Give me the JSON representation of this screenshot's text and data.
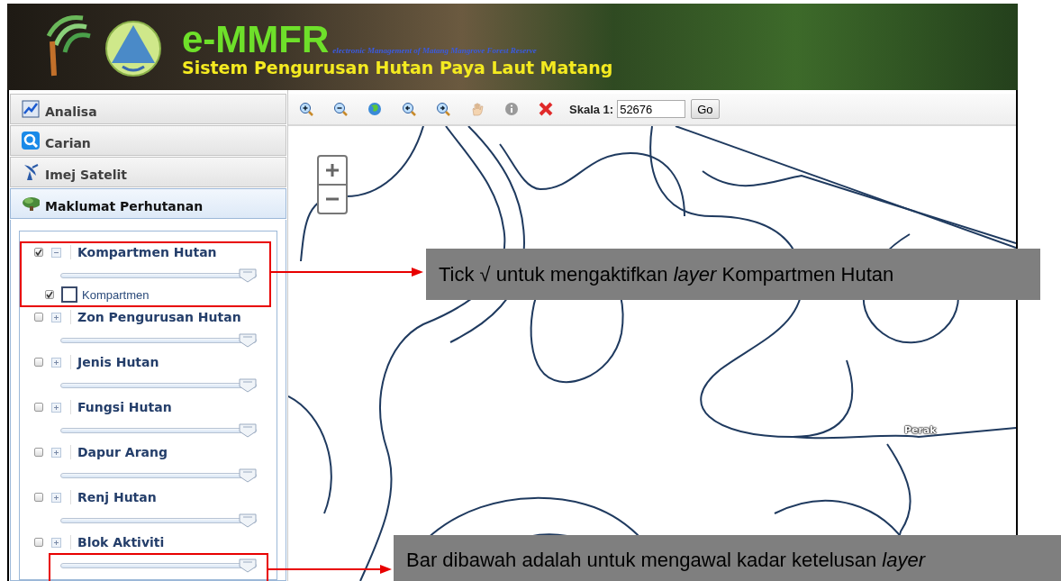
{
  "header": {
    "title": "e-MMFR",
    "tagline": "electronic Management of Matang Mangrove Forest Reserve",
    "subtitle": "Sistem Pengurusan Hutan Paya Laut Matang"
  },
  "sidebar": {
    "panels": [
      {
        "label": "Analisa",
        "expanded": false
      },
      {
        "label": "Carian",
        "expanded": false
      },
      {
        "label": "Imej Satelit",
        "expanded": false
      },
      {
        "label": "Maklumat Perhutanan",
        "expanded": true
      }
    ],
    "layers": [
      {
        "label": "Kompartmen Hutan",
        "checked": true,
        "expanded": true,
        "level": 1,
        "children": [
          {
            "label": "Kompartmen",
            "checked": true
          }
        ]
      },
      {
        "label": "Zon Pengurusan Hutan",
        "checked": false,
        "expanded": false,
        "level": 1
      },
      {
        "label": "Jenis Hutan",
        "checked": false,
        "expanded": false,
        "level": 1
      },
      {
        "label": "Fungsi Hutan",
        "checked": false,
        "expanded": false,
        "level": 1
      },
      {
        "label": "Dapur Arang",
        "checked": false,
        "expanded": false,
        "level": 1
      },
      {
        "label": "Renj Hutan",
        "checked": false,
        "expanded": false,
        "level": 1
      },
      {
        "label": "Blok Aktiviti",
        "checked": false,
        "expanded": false,
        "level": 1
      }
    ]
  },
  "toolbar": {
    "scale_label": "Skala 1:",
    "scale_value": "52676",
    "go_button": "Go"
  },
  "map": {
    "labels": [
      "Perak"
    ]
  },
  "annotations": [
    {
      "text": "Tick √ untuk mengaktifkan *layer* Kompartmen Hutan"
    },
    {
      "text": "Bar dibawah adalah untuk mengawal kadar ketelusan *layer*"
    }
  ]
}
